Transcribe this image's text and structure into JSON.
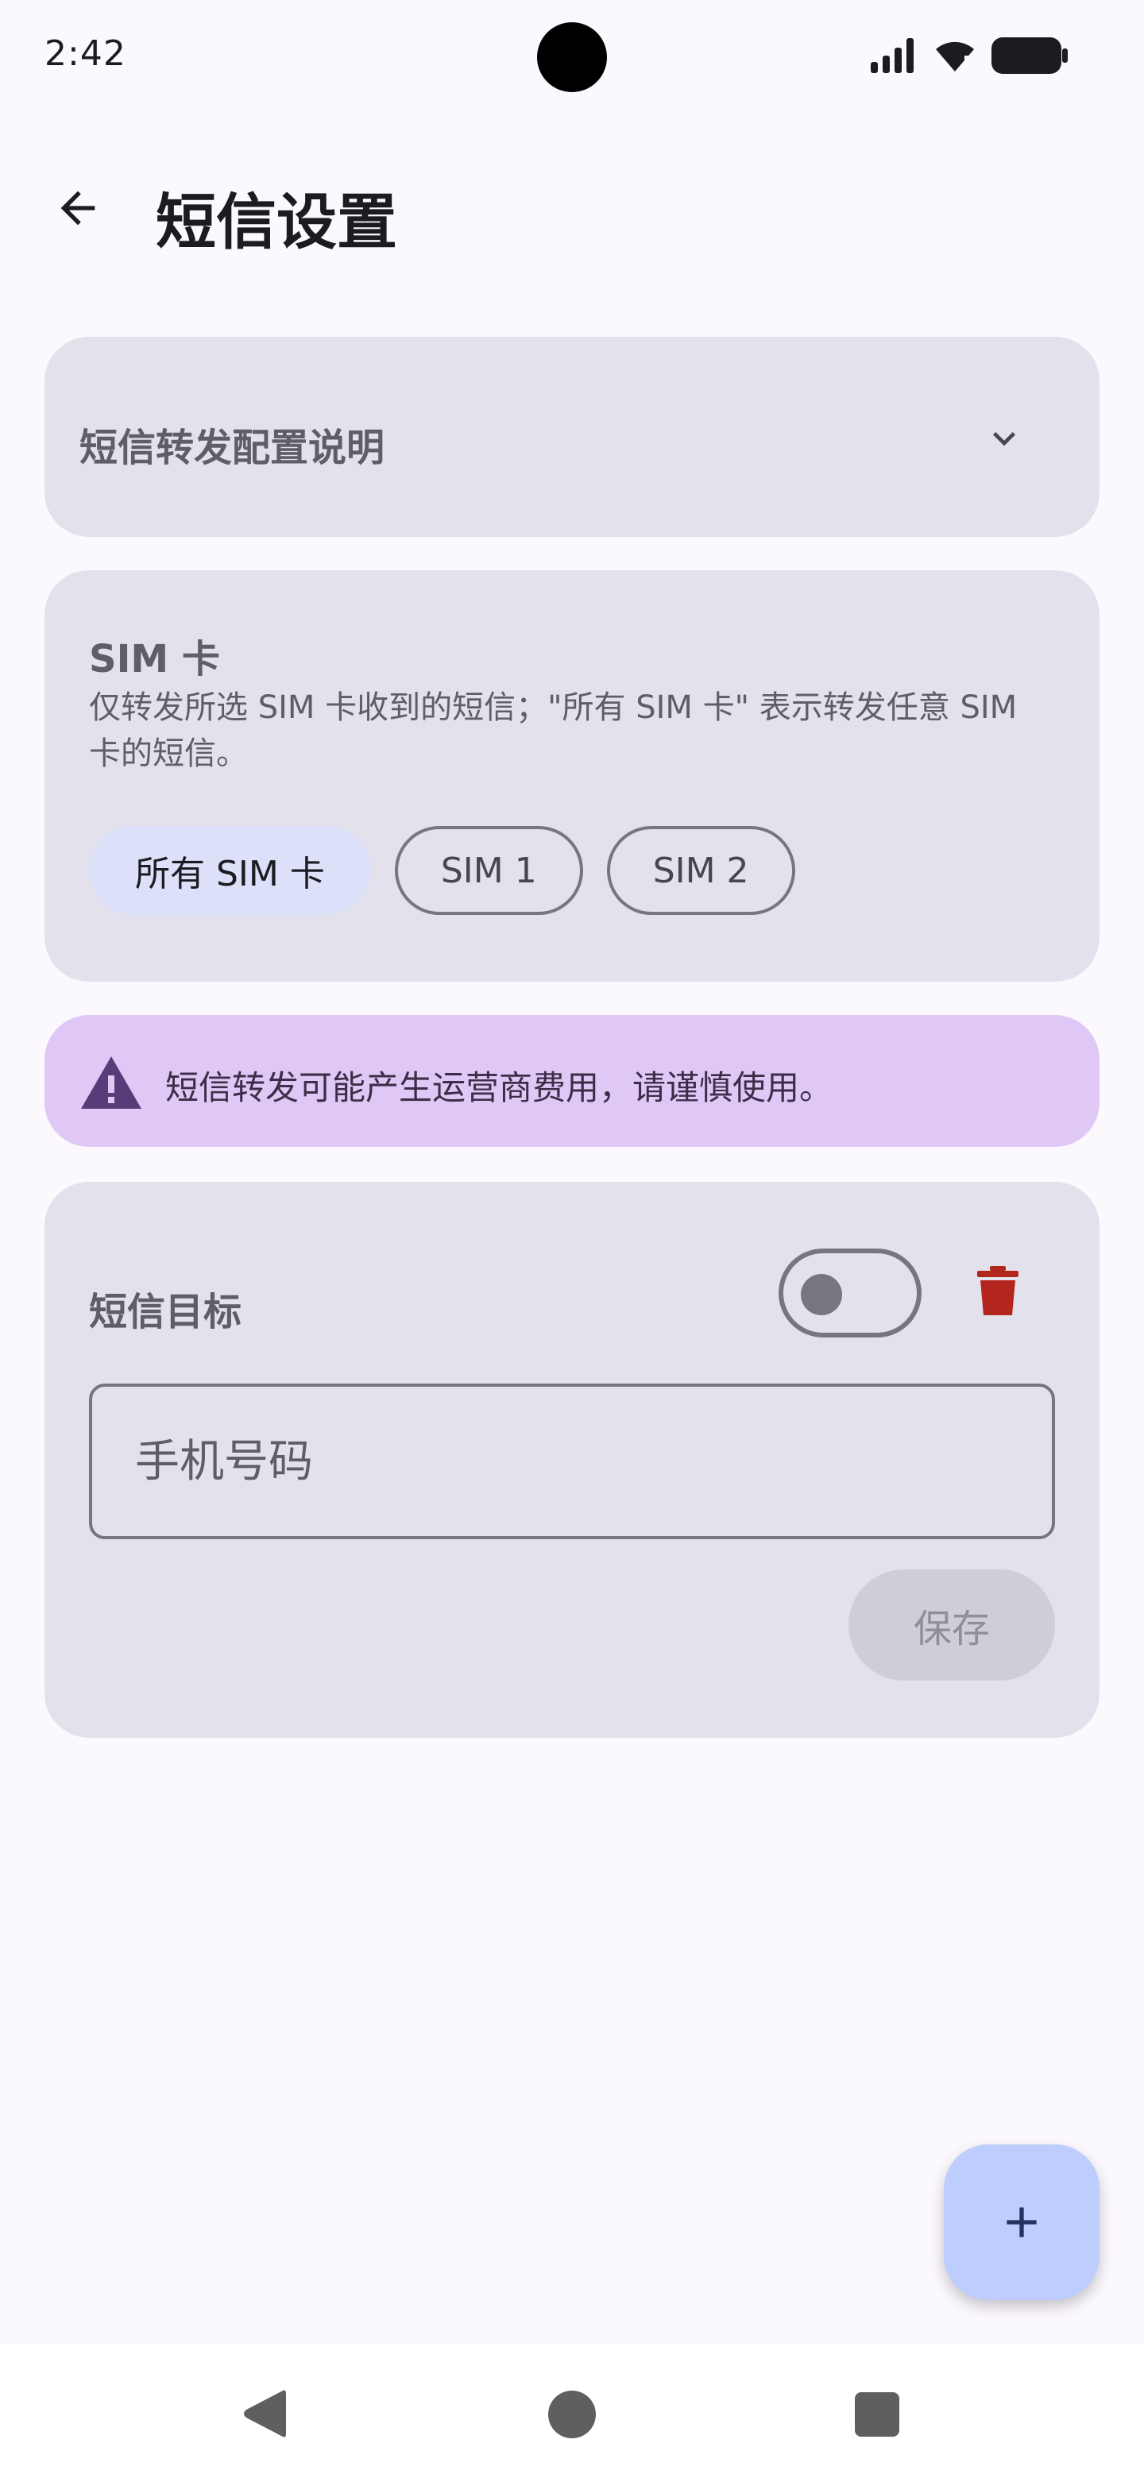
{
  "status_bar": {
    "time": "2:42",
    "icons": [
      "signal-icon",
      "wifi-icon",
      "battery-icon"
    ]
  },
  "app_bar": {
    "back_icon": "arrow-back-icon",
    "title": "短信设置"
  },
  "instructions_card": {
    "title": "短信转发配置说明",
    "expand_icon": "chevron-down-icon"
  },
  "sim_card": {
    "title": "SIM 卡",
    "description": "仅转发所选 SIM 卡收到的短信；\"所有 SIM 卡\" 表示转发任意 SIM 卡的短信。",
    "options": [
      {
        "label": "所有 SIM 卡",
        "selected": true
      },
      {
        "label": "SIM 1",
        "selected": false
      },
      {
        "label": "SIM 2",
        "selected": false
      }
    ]
  },
  "warning": {
    "icon": "warning-icon",
    "text": "短信转发可能产生运营商费用，请谨慎使用。"
  },
  "target_card": {
    "title": "短信目标",
    "toggle_on": false,
    "delete_icon": "trash-icon",
    "phone_placeholder": "手机号码",
    "phone_value": "",
    "save_label": "保存"
  },
  "fab": {
    "icon": "add-icon"
  },
  "colors": {
    "background": "#fbf8fe",
    "card": "#e3e1ec",
    "selected_chip": "#dce1f9",
    "warning_bg": "#e0c8f6",
    "delete": "#b3261e",
    "fab": "#bdcdfe"
  }
}
